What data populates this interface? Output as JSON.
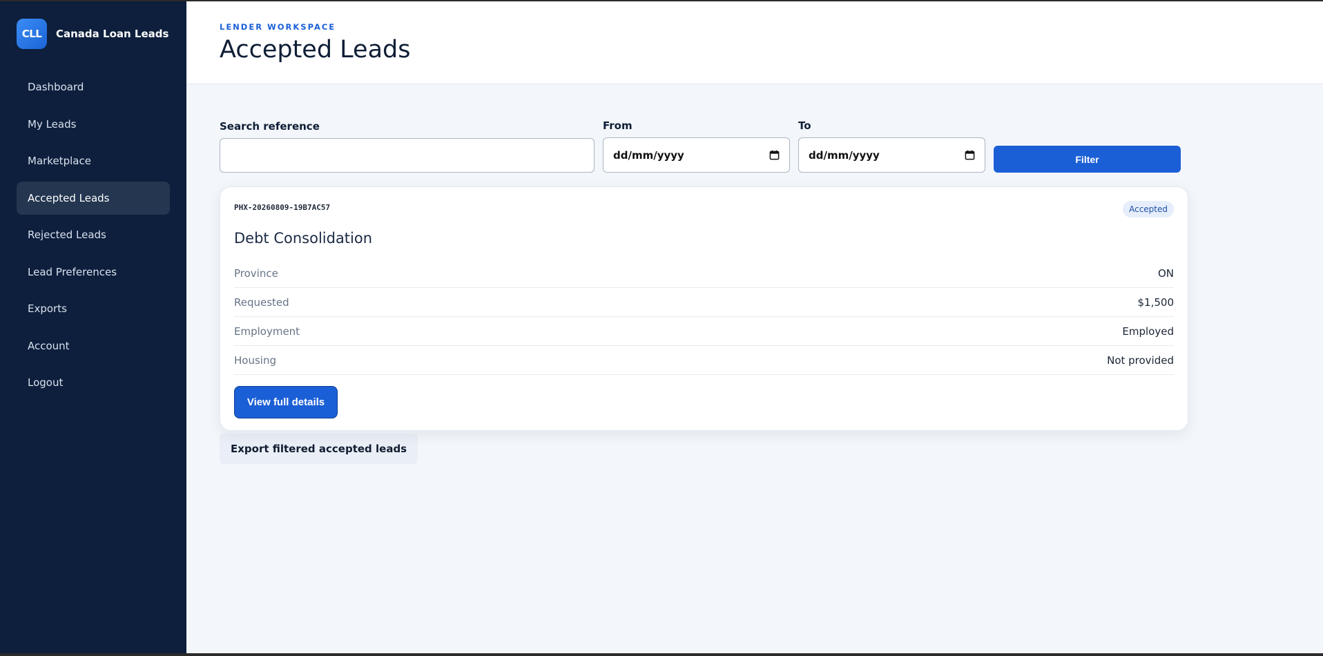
{
  "brand": {
    "logo_text": "CLL",
    "name": "Canada Loan Leads"
  },
  "sidebar": {
    "items": [
      {
        "label": "Dashboard",
        "active": false
      },
      {
        "label": "My Leads",
        "active": false
      },
      {
        "label": "Marketplace",
        "active": false
      },
      {
        "label": "Accepted Leads",
        "active": true
      },
      {
        "label": "Rejected Leads",
        "active": false
      },
      {
        "label": "Lead Preferences",
        "active": false
      },
      {
        "label": "Exports",
        "active": false
      },
      {
        "label": "Account",
        "active": false
      },
      {
        "label": "Logout",
        "active": false
      }
    ]
  },
  "header": {
    "eyebrow": "LENDER WORKSPACE",
    "title": "Accepted Leads"
  },
  "filters": {
    "search_label": "Search reference",
    "search_value": "",
    "from_label": "From",
    "from_value": "dd/mm/yyyy",
    "to_label": "To",
    "to_value": "dd/mm/yyyy",
    "filter_button": "Filter"
  },
  "lead": {
    "reference": "PHX-20260809-19B7AC57",
    "status": "Accepted",
    "title": "Debt Consolidation",
    "rows": [
      {
        "key": "Province",
        "value": "ON"
      },
      {
        "key": "Requested",
        "value": "$1,500"
      },
      {
        "key": "Employment",
        "value": "Employed"
      },
      {
        "key": "Housing",
        "value": "Not provided"
      }
    ],
    "details_button": "View full details"
  },
  "export_button": "Export filtered accepted leads",
  "colors": {
    "sidebar_bg": "#0d1f3c",
    "accent": "#1b5fd6",
    "page_bg": "#f3f6fa"
  },
  "icons": {
    "date_picker": "calendar-icon"
  }
}
